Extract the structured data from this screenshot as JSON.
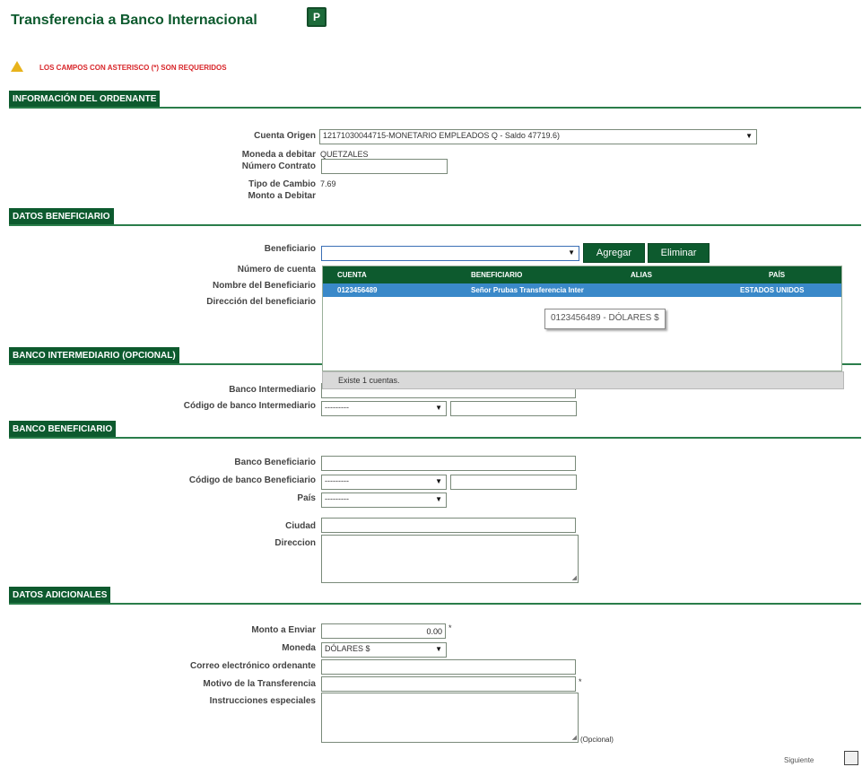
{
  "header": {
    "title": "Transferencia a Banco Internacional",
    "help_glyph": "P"
  },
  "required_notice": "LOS CAMPOS CON ASTERISCO (*) SON REQUERIDOS",
  "sections": {
    "ordenante": "INFORMACIÓN DEL ORDENANTE",
    "beneficiario": "DATOS BENEFICIARIO",
    "intermediario": "BANCO INTERMEDIARIO (OPCIONAL)",
    "banco_beneficiario": "BANCO BENEFICIARIO",
    "adicionales": "DATOS ADICIONALES"
  },
  "ordenante": {
    "cuenta_origen_label": "Cuenta Origen",
    "cuenta_origen_value": "12171030044715-MONETARIO EMPLEADOS Q - Saldo 47719.6)",
    "moneda_label": "Moneda a debitar",
    "moneda_value": "QUETZALES",
    "contrato_label": "Número Contrato",
    "tipo_cambio_label": "Tipo de Cambio",
    "tipo_cambio_value": "7.69",
    "monto_debitar_label": "Monto a Debitar"
  },
  "beneficiario": {
    "beneficiario_label": "Beneficiario",
    "add_button": "Agregar",
    "delete_button": "Eliminar",
    "numero_cuenta_label": "Número de cuenta",
    "nombre_label": "Nombre del Beneficiario",
    "direccion_label": "Dirección del beneficiario",
    "dropdown": {
      "columns": [
        "CUENTA",
        "BENEFICIARIO",
        "ALIAS",
        "PAÍS"
      ],
      "rows": [
        {
          "cuenta": "0123456489",
          "beneficiario": "Señor Prubas Transferencia Inter",
          "alias": "",
          "pais": "ESTADOS UNIDOS"
        }
      ],
      "footer": "Existe 1 cuentas.",
      "tooltip": "0123456489 - DÓLARES $"
    }
  },
  "intermediario": {
    "banco_label": "Banco Intermediario",
    "codigo_label": "Código de banco Intermediario",
    "codigo_select": "---------"
  },
  "banco_beneficiario": {
    "banco_label": "Banco Beneficiario",
    "codigo_label": "Código de banco Beneficiario",
    "codigo_select": "---------",
    "pais_label": "País",
    "pais_select": "---------",
    "ciudad_label": "Ciudad",
    "direccion_label": "Direccion"
  },
  "adicionales": {
    "monto_label": "Monto a Enviar",
    "monto_value": "0.00",
    "monto_marker": "*",
    "moneda_label": "Moneda",
    "moneda_value": "DÓLARES $",
    "correo_label": "Correo electrónico ordenante",
    "motivo_label": "Motivo de la Transferencia",
    "motivo_marker": "*",
    "instrucciones_label": "Instrucciones especiales",
    "opcional": "(Opcional)"
  },
  "footer": {
    "next_label": "Siguiente"
  },
  "icons": {
    "warning": "warning-icon",
    "help": "help-icon",
    "next": "next-icon",
    "dropdown": "chevron-down-icon"
  },
  "colors": {
    "brand_green": "#0d5a2e",
    "selected_row": "#3a89c9",
    "warning_red": "#d8262a",
    "warning_yellow": "#e8b31c"
  }
}
